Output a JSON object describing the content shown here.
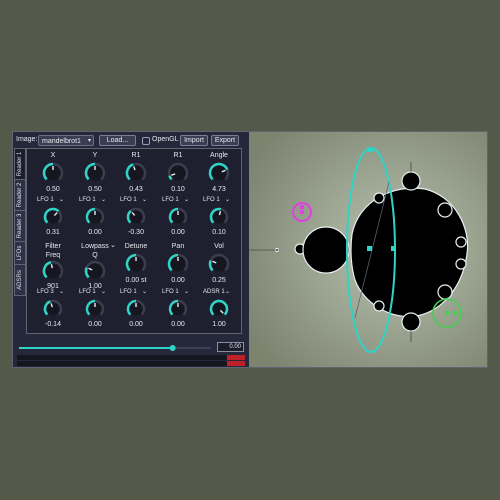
{
  "topbar": {
    "image_label": "Image:",
    "image_select": "mandelbrot1",
    "load_button": "Load...",
    "opengl_label": "OpenGL",
    "import_button": "Import",
    "export_button": "Export"
  },
  "tabs": [
    "Reader 1",
    "Reader 2",
    "Reader 3",
    "LFOs",
    "ADSRs"
  ],
  "rows": {
    "row1": [
      {
        "title": "X",
        "value": "0.50",
        "level": 0.5
      },
      {
        "title": "Y",
        "value": "0.50",
        "level": 0.5
      },
      {
        "title": "R1",
        "value": "0.43",
        "level": 0.43
      },
      {
        "title": "R1",
        "value": "0.10",
        "level": 0.1
      },
      {
        "title": "Angle",
        "value": "4.73",
        "level": 0.75
      }
    ],
    "row2": [
      {
        "lfo": "LFO 1",
        "value": "0.31",
        "level": 0.66
      },
      {
        "lfo": "LFO 1",
        "value": "0.00",
        "level": 0.5
      },
      {
        "lfo": "LFO 1",
        "value": "-0.30",
        "level": 0.35
      },
      {
        "lfo": "LFO 1",
        "value": "0.00",
        "level": 0.5
      },
      {
        "lfo": "LFO 1",
        "value": "0.10",
        "level": 0.55
      }
    ],
    "row3": [
      {
        "title": "Filter",
        "title2": "Freq",
        "value": "901",
        "level": 0.45
      },
      {
        "title": "Lowpass",
        "title2": "Q",
        "value": "1.00",
        "level": 0.25
      },
      {
        "title": "Detune",
        "value": "0.00 st",
        "level": 0.5
      },
      {
        "title": "Pan",
        "value": "0.00",
        "level": 0.5
      },
      {
        "title": "Vol",
        "value": "0.25",
        "level": 0.25
      }
    ],
    "row4": [
      {
        "lfo": "LFO 3",
        "value": "-0.14",
        "level": 0.43
      },
      {
        "lfo": "LFO 1",
        "value": "0.00",
        "level": 0.5
      },
      {
        "lfo": "LFO 1",
        "value": "0.00",
        "level": 0.5
      },
      {
        "lfo": "LFO 1",
        "value": "0.00",
        "level": 0.5
      },
      {
        "lfo": "ADSR 1",
        "value": "1.00",
        "level": 1.0
      }
    ]
  },
  "bottom": {
    "slider_level": 0.8,
    "number_value": "0.00"
  },
  "colors": {
    "accent": "#2fd4c6",
    "knob_track": "#1a1a24",
    "panel_bg": "#25273a",
    "meter_red": "#c0202a",
    "marker_magenta": "#e040e0",
    "marker_green": "#44d050"
  }
}
